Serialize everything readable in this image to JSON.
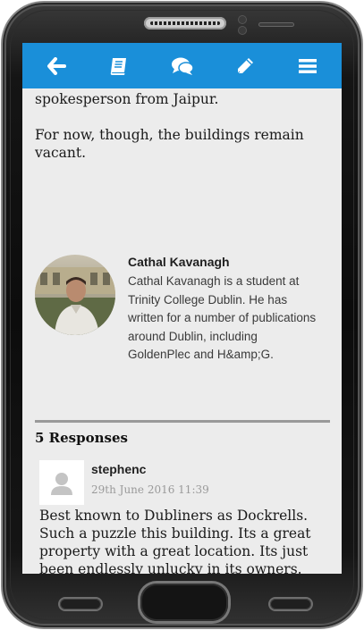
{
  "colors": {
    "app_bar": "#1a8fd9",
    "screen_background": "#ececec",
    "icon": "#ffffff"
  },
  "nav": {
    "items": [
      {
        "icon": "back-arrow-icon"
      },
      {
        "icon": "book-icon"
      },
      {
        "icon": "comments-icon"
      },
      {
        "icon": "pencil-icon"
      },
      {
        "icon": "menu-icon"
      }
    ]
  },
  "article": {
    "paragraphs": [
      "spokesperson from Jaipur.",
      "For now, though, the buildings remain vacant."
    ]
  },
  "author": {
    "name": "Cathal Kavanagh",
    "bio": "Cathal Kavanagh is a student at Trinity College Dublin. He has written for a number of publications around Dublin, including GoldenPlec and H&amp;G."
  },
  "responses": {
    "heading": "5 Responses",
    "comments": [
      {
        "author": "stephenc",
        "date": "29th June 2016 11:39",
        "body": "Best known to Dubliners as Dockrells. Such a puzzle this building. Its a great property with a great location. Its just been endlessly unlucky in its owners."
      }
    ]
  }
}
